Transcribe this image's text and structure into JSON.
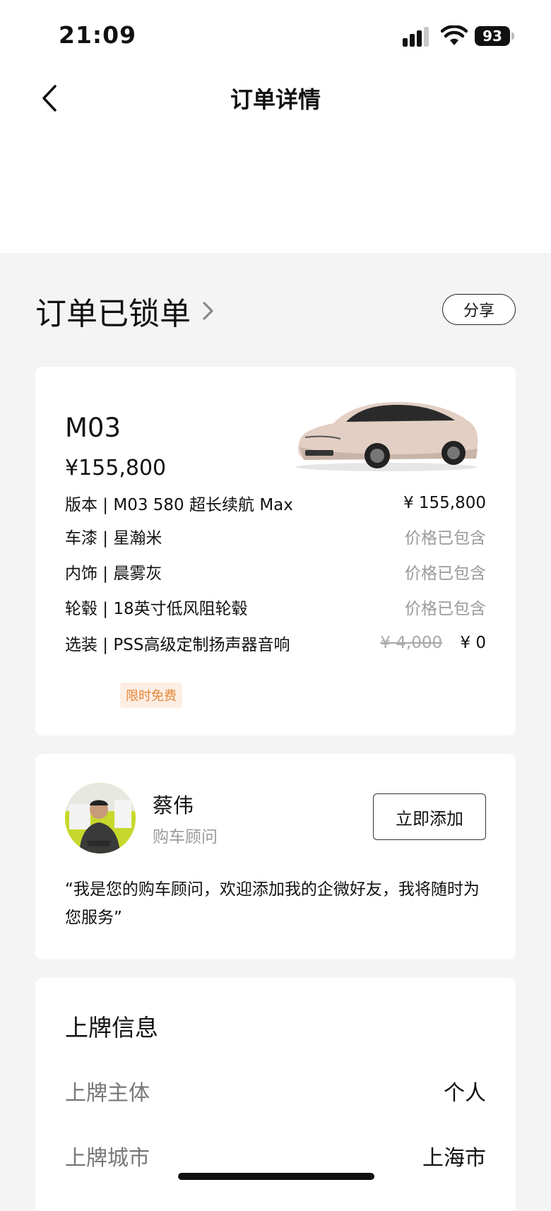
{
  "status_bar": {
    "time": "21:09",
    "battery": "93"
  },
  "nav": {
    "title": "订单详情"
  },
  "order": {
    "status": "订单已锁单",
    "share_label": "分享"
  },
  "car": {
    "model": "M03",
    "price": "¥155,800",
    "specs": [
      {
        "label": "版本 | M03 580 超长续航 Max",
        "value": "¥ 155,800"
      },
      {
        "label": "车漆 | 星瀚米",
        "value": "价格已包含"
      },
      {
        "label": "内饰 | 晨雾灰",
        "value": "价格已包含"
      },
      {
        "label": "轮毂 | 18英寸低风阻轮毂",
        "value": "价格已包含"
      },
      {
        "label": "选装 | PSS高级定制扬声器音响",
        "original": "¥ 4,000",
        "value": "¥ 0"
      }
    ],
    "badge": "限时免费"
  },
  "consultant": {
    "name": "蔡伟",
    "role": "购车顾问",
    "add_label": "立即添加",
    "quote": "“我是您的购车顾问，欢迎添加我的企微好友，我将随时为您服务”"
  },
  "plate": {
    "title": "上牌信息",
    "rows": [
      {
        "label": "上牌主体",
        "value": "个人"
      },
      {
        "label": "上牌城市",
        "value": "上海市"
      }
    ]
  },
  "colors": {
    "badge_text": "#e6883b",
    "badge_bg": "#fdeee3",
    "car_paint": "#e3cfc4"
  }
}
